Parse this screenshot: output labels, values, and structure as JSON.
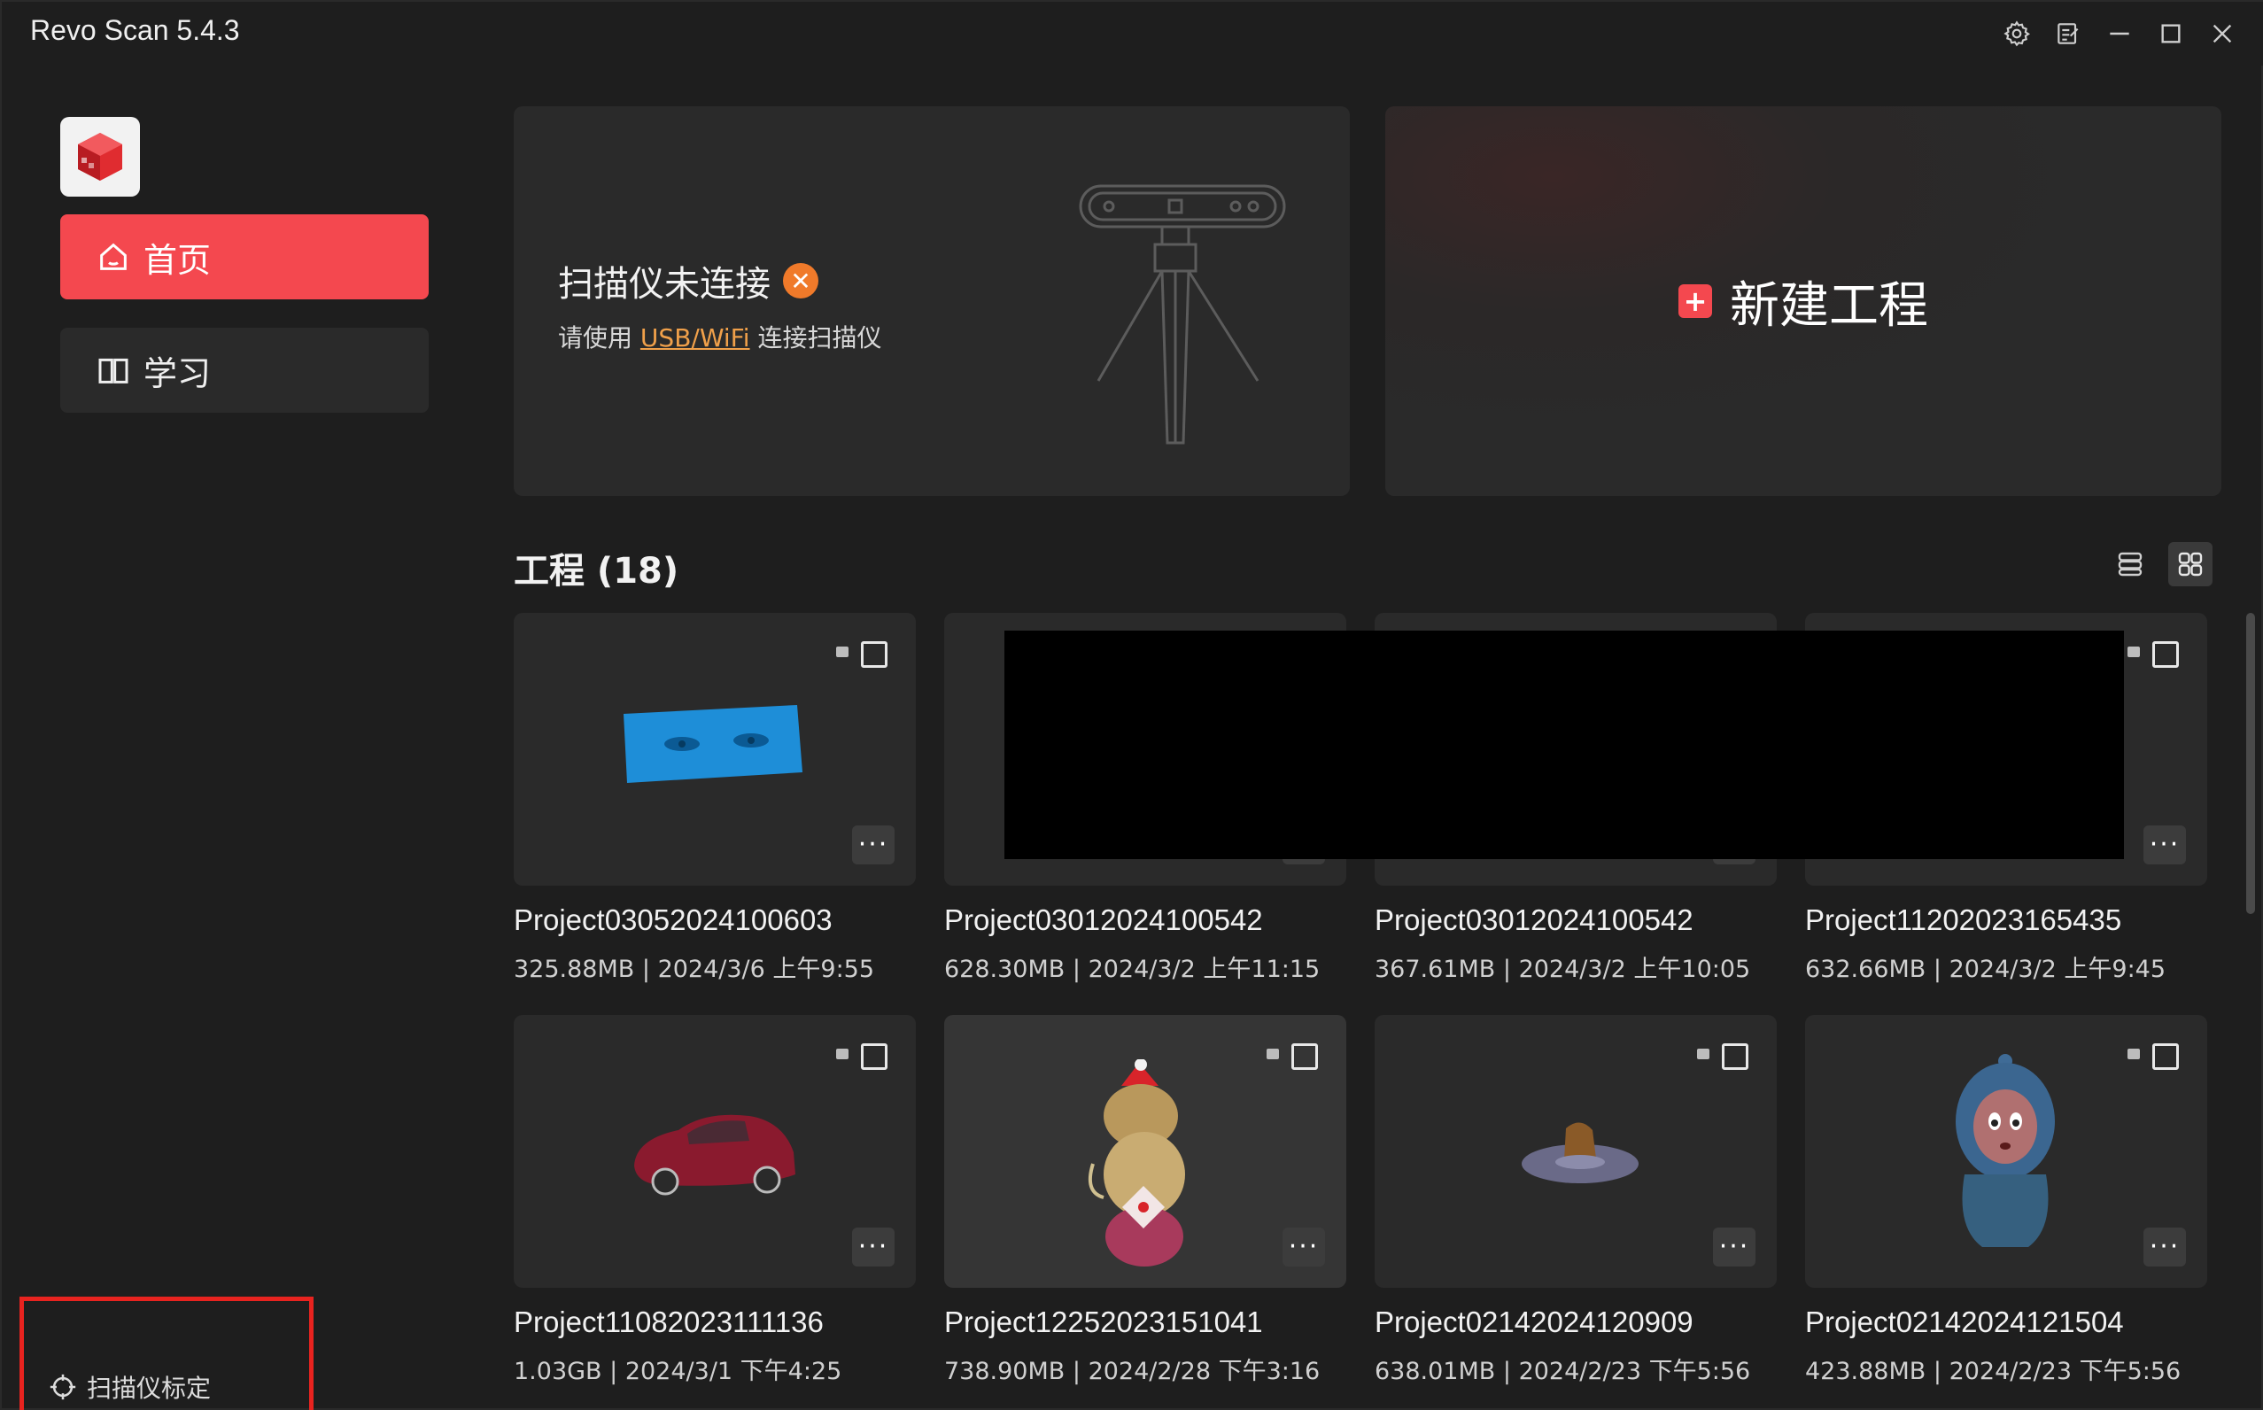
{
  "app": {
    "title": "Revo Scan 5.4.3"
  },
  "titlebar_icons": [
    "gear-icon",
    "notes-icon",
    "minimize-icon",
    "maximize-icon",
    "close-icon"
  ],
  "sidebar": {
    "items": [
      {
        "label": "首页",
        "icon": "home-icon",
        "active": true
      },
      {
        "label": "学习",
        "icon": "book-icon",
        "active": false
      }
    ],
    "calibration_label": "扫描仪标定"
  },
  "scanner": {
    "status_title": "扫描仪未连接",
    "hint_prefix": "请使用",
    "hint_link": "USB/WiFi",
    "hint_suffix": "连接扫描仪"
  },
  "new_project": {
    "label": "新建工程"
  },
  "projects_header": {
    "title": "工程 (18)"
  },
  "colors": {
    "accent": "#f4484f",
    "warning": "#f07a2a",
    "link": "#f0a04a",
    "highlight": "#e8231f"
  },
  "projects": [
    {
      "name": "Project03052024100603",
      "size": "325.88MB",
      "date": "2024/3/6 上午9:55"
    },
    {
      "name": "Project03012024100542",
      "size": "628.30MB",
      "date": "2024/3/2 上午11:15"
    },
    {
      "name": "Project03012024100542",
      "size": "367.61MB",
      "date": "2024/3/2 上午10:05"
    },
    {
      "name": "Project11202023165435",
      "size": "632.66MB",
      "date": "2024/3/2 上午9:45"
    },
    {
      "name": "Project11082023111136",
      "size": "1.03GB",
      "date": "2024/3/1 下午4:25"
    },
    {
      "name": "Project12252023151041",
      "size": "738.90MB",
      "date": "2024/2/28 下午3:16"
    },
    {
      "name": "Project02142024120909",
      "size": "638.01MB",
      "date": "2024/2/23 下午5:56"
    },
    {
      "name": "Project02142024121504",
      "size": "423.88MB",
      "date": "2024/2/23 下午5:56"
    }
  ]
}
